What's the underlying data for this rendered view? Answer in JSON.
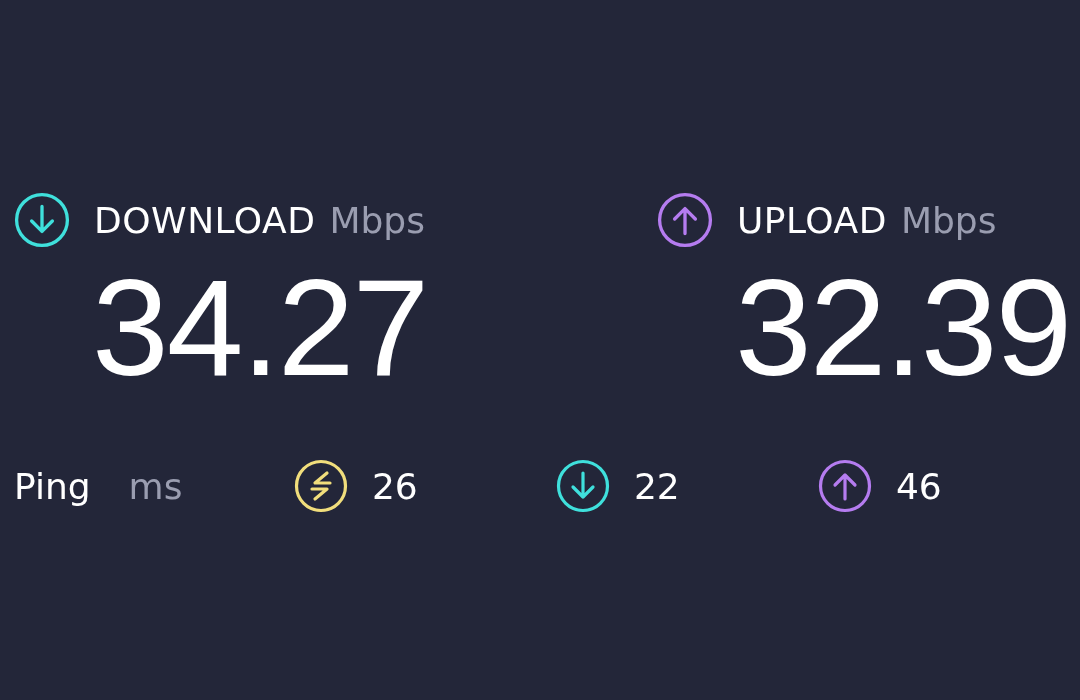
{
  "metrics": [
    {
      "kind": "down",
      "label": "DOWNLOAD",
      "unit": "Mbps",
      "value": "34.27",
      "color": "#3fe0dc"
    },
    {
      "kind": "up",
      "label": "UPLOAD",
      "unit": "Mbps",
      "value": "32.39",
      "color": "#b57cf0"
    }
  ],
  "ping": {
    "label": "Ping",
    "unit": "ms",
    "items": [
      {
        "kind": "exchange",
        "value": "26",
        "color": "#f1de7c"
      },
      {
        "kind": "down",
        "value": "22",
        "color": "#3fe0dc"
      },
      {
        "kind": "up",
        "value": "46",
        "color": "#b57cf0"
      }
    ]
  }
}
